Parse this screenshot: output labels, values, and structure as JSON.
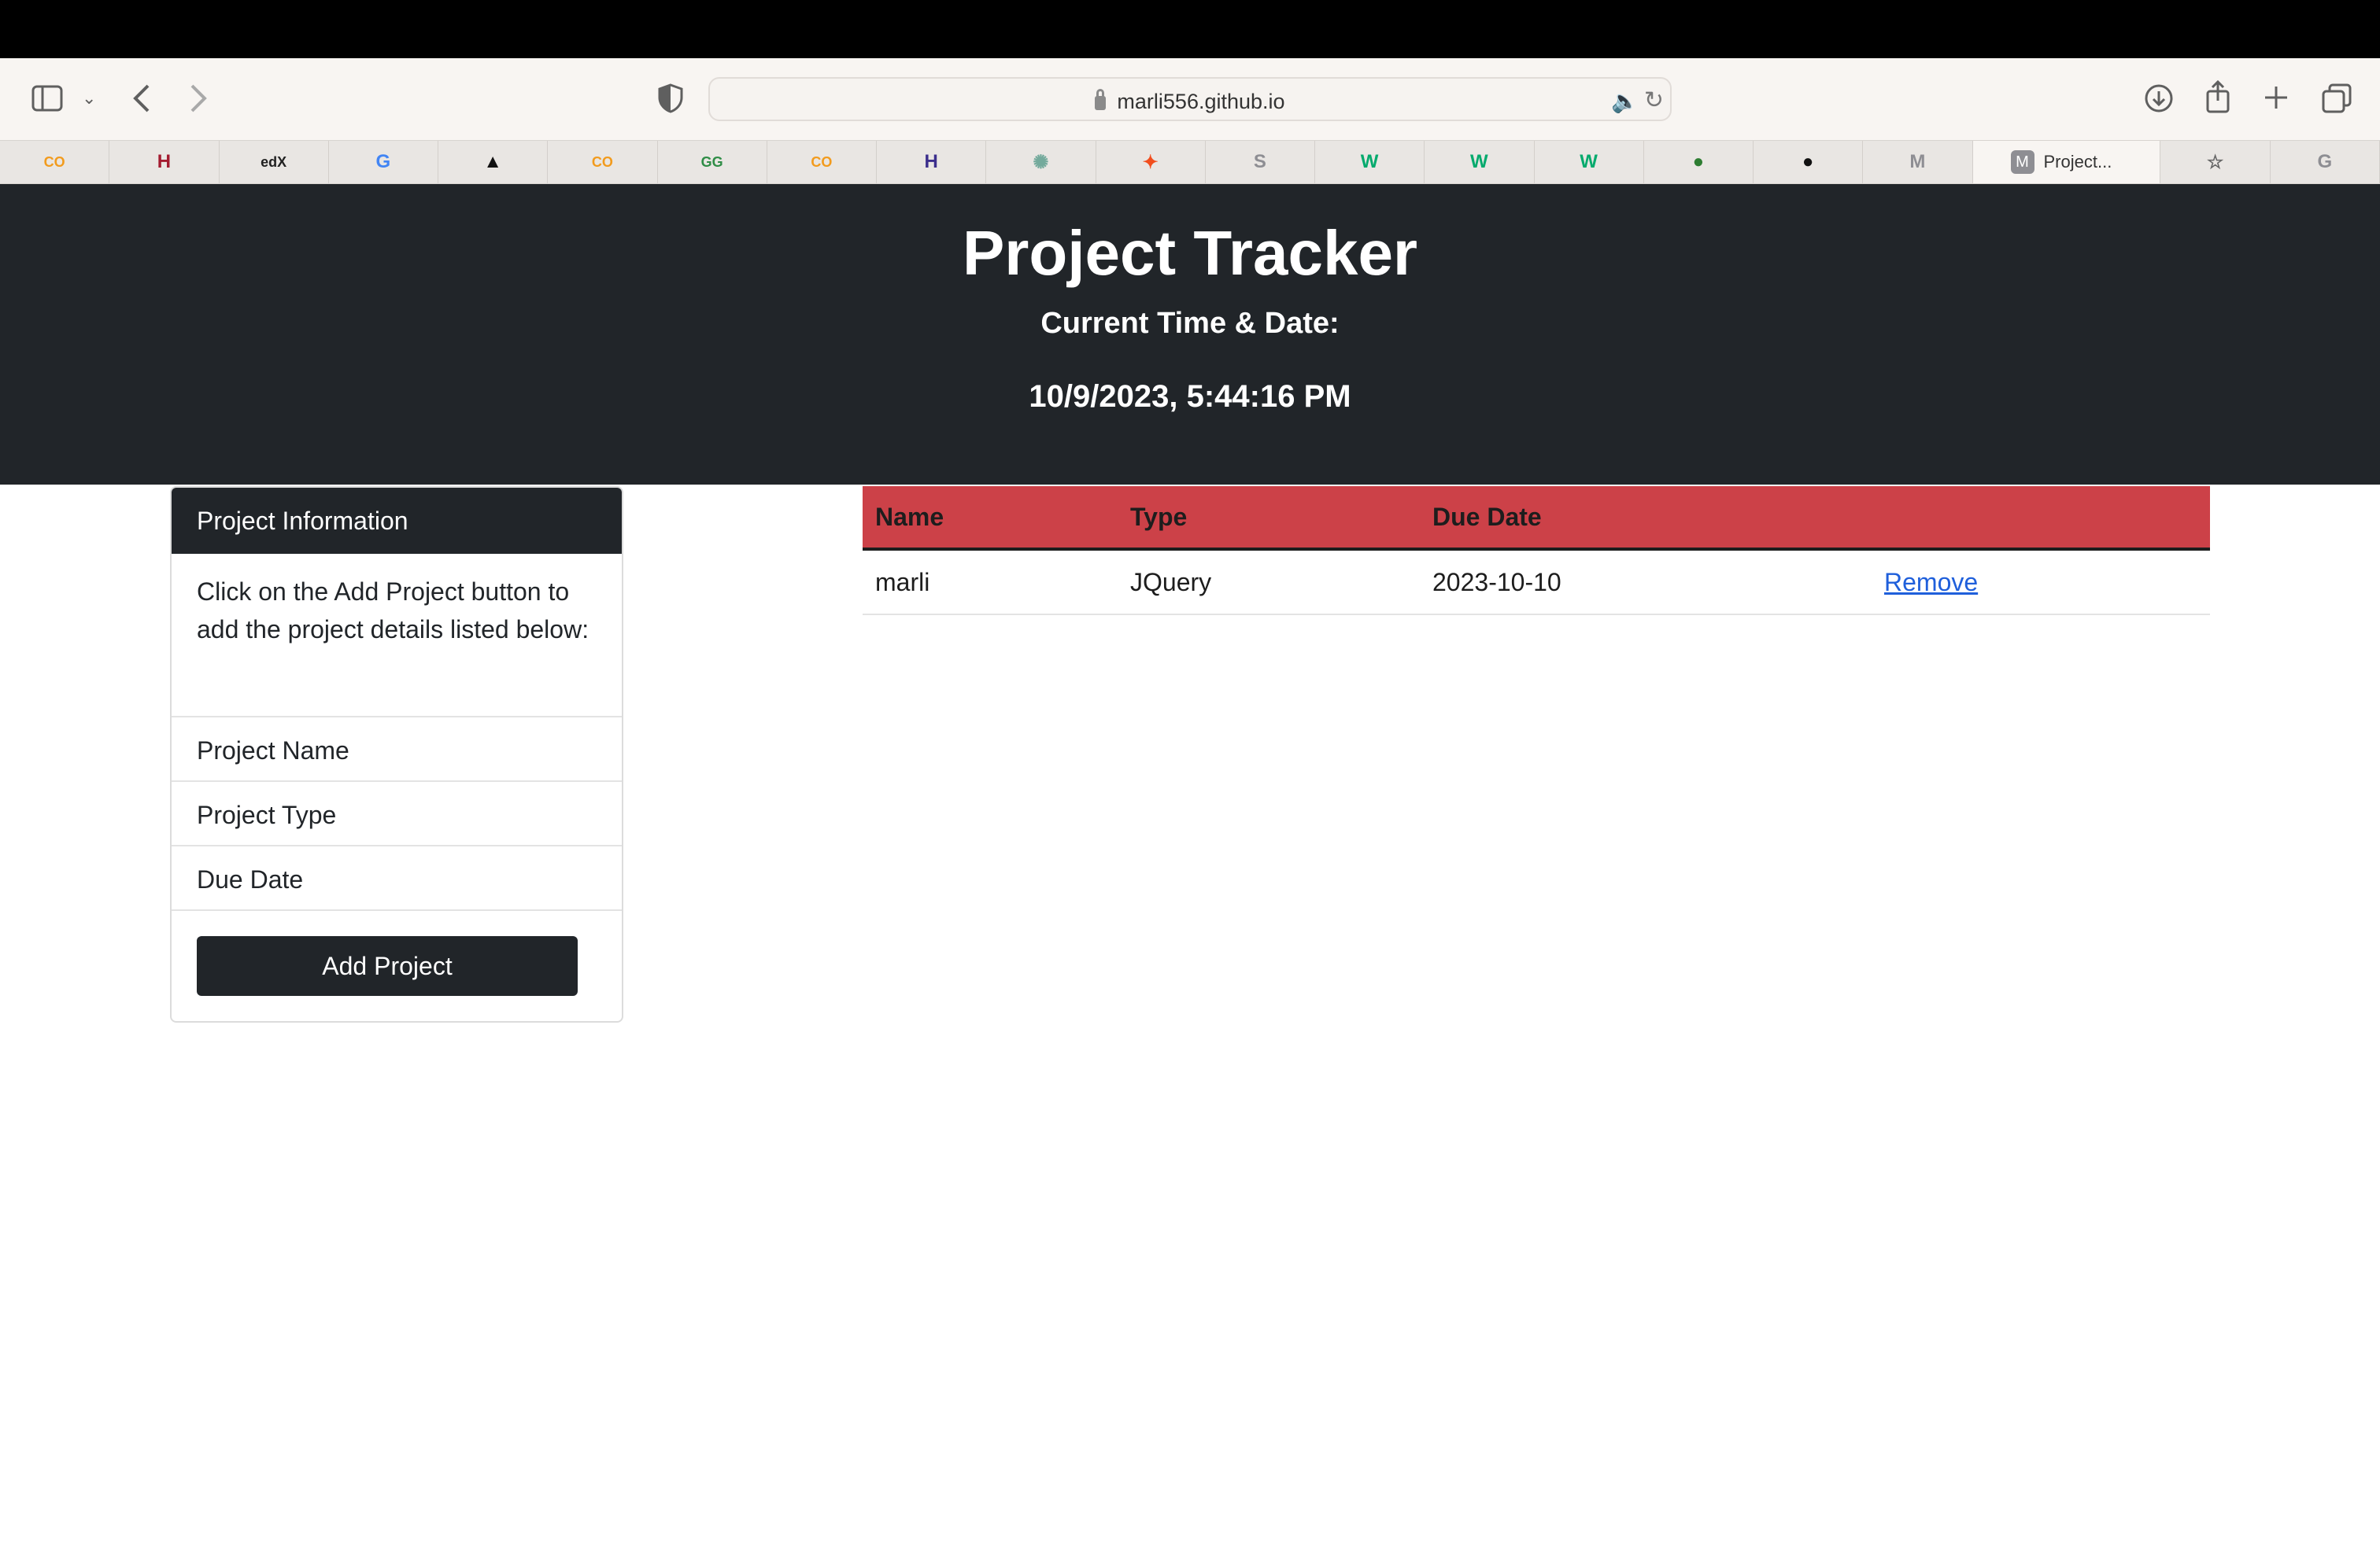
{
  "browser": {
    "url": "marli556.github.io",
    "active_tab_label": "Project...",
    "tabs": [
      {
        "icon": "colab-icon",
        "glyph": "CO",
        "color": "#f29b1d"
      },
      {
        "icon": "harvard-icon",
        "glyph": "H",
        "color": "#a41c30"
      },
      {
        "icon": "edx-icon",
        "glyph": "edX",
        "color": "#222222"
      },
      {
        "icon": "google-icon",
        "glyph": "G",
        "color": "#4285f4"
      },
      {
        "icon": "dark-app-icon",
        "glyph": "▲",
        "color": "#111111"
      },
      {
        "icon": "colab-icon",
        "glyph": "CO",
        "color": "#f29b1d"
      },
      {
        "icon": "geeksforgeeks-icon",
        "glyph": "GG",
        "color": "#2f8d46"
      },
      {
        "icon": "colab-icon",
        "glyph": "CO",
        "color": "#f29b1d"
      },
      {
        "icon": "hackerrank-icon",
        "glyph": "H",
        "color": "#3c2e8c"
      },
      {
        "icon": "chatgpt-icon",
        "glyph": "✺",
        "color": "#74aa9c"
      },
      {
        "icon": "figma-icon",
        "glyph": "✦",
        "color": "#f24e1e"
      },
      {
        "icon": "s-icon",
        "glyph": "S",
        "color": "#8e8e93"
      },
      {
        "icon": "w3schools-icon",
        "glyph": "W",
        "color": "#04aa6d"
      },
      {
        "icon": "w3schools-icon",
        "glyph": "W",
        "color": "#04aa6d"
      },
      {
        "icon": "w3schools-icon",
        "glyph": "W",
        "color": "#04aa6d"
      },
      {
        "icon": "circle-app-icon",
        "glyph": "●",
        "color": "#2e7d32"
      },
      {
        "icon": "github-icon",
        "glyph": "●",
        "color": "#111111"
      },
      {
        "icon": "m-icon",
        "glyph": "M",
        "color": "#8e8e93"
      }
    ],
    "trailing_tabs": [
      {
        "icon": "star-icon",
        "glyph": "☆",
        "color": "#666666"
      },
      {
        "icon": "g-icon",
        "glyph": "G",
        "color": "#8e8e93"
      }
    ]
  },
  "header": {
    "title": "Project Tracker",
    "time_label": "Current Time & Date:",
    "time_value": "10/9/2023, 5:44:16 PM"
  },
  "card": {
    "header": "Project Information",
    "instructions": "Click on the Add Project button to add the project details listed below:",
    "items": [
      "Project Name",
      "Project Type",
      "Due Date"
    ],
    "button_label": "Add Project"
  },
  "table": {
    "columns": [
      "Name",
      "Type",
      "Due Date"
    ],
    "rows": [
      {
        "name": "marli",
        "type": "JQuery",
        "due_date": "2023-10-10",
        "action": "Remove"
      }
    ]
  },
  "colors": {
    "header_bg": "#212529",
    "table_header_bg": "#cc4148",
    "link": "#1f5fdb"
  }
}
